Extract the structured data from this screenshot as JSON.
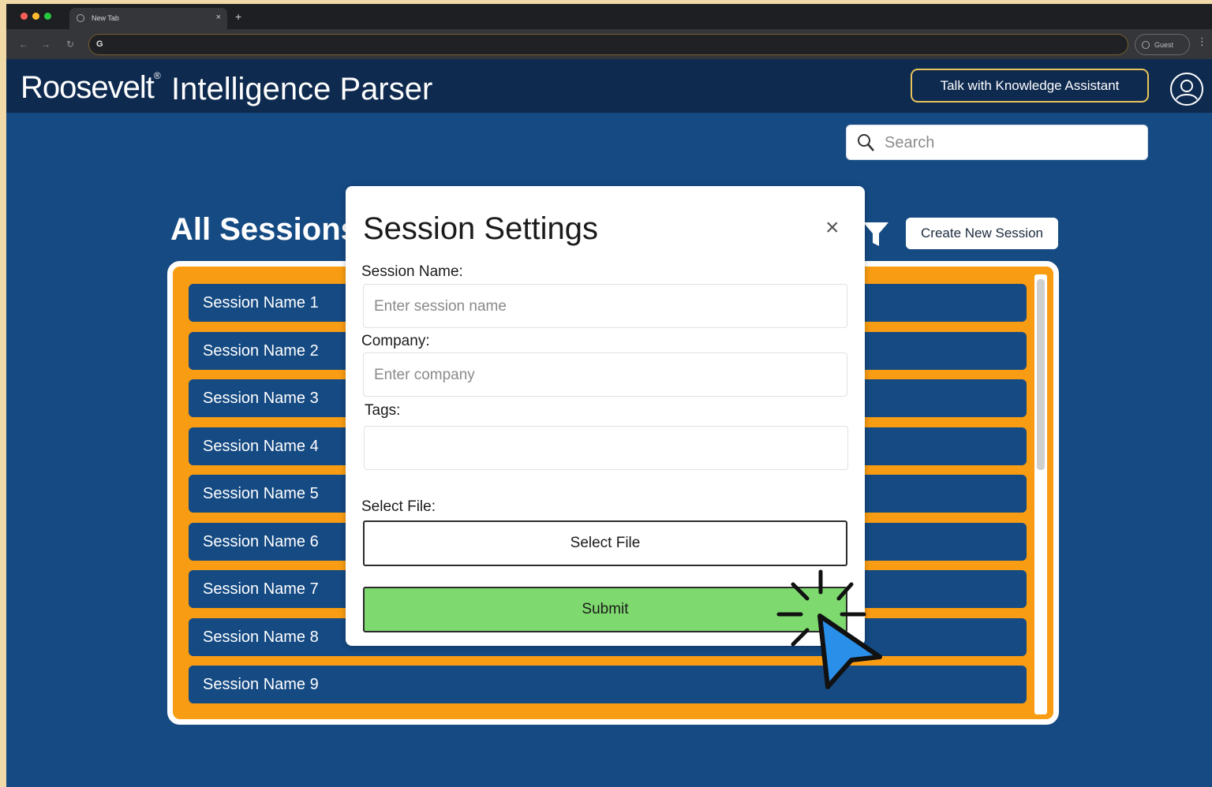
{
  "browser": {
    "tab_title": "New Tab",
    "tab_close": "×",
    "new_tab": "+",
    "omnibox_icon": "G",
    "guest_label": "Guest",
    "menu": "⋮",
    "nav_back": "←",
    "nav_forward": "→",
    "reload": "↻"
  },
  "header": {
    "logo": "Roosevelt",
    "logo_mark": "®",
    "title": "Intelligence Parser",
    "assistant_label": "Talk with Knowledge Assistant"
  },
  "search": {
    "placeholder": "Search"
  },
  "sessions": {
    "title": "All Sessions",
    "create_label": "Create New Session",
    "items": [
      "Session Name 1",
      "Session Name 2",
      "Session Name 3",
      "Session Name 4",
      "Session Name 5",
      "Session Name 6",
      "Session Name 7",
      "Session Name 8",
      "Session Name 9"
    ]
  },
  "modal": {
    "title": "Session Settings",
    "close": "×",
    "session_name_label": "Session Name:",
    "session_name_placeholder": "Enter session name",
    "company_label": "Company:",
    "company_placeholder": "Enter company",
    "tags_label": "Tags:",
    "select_file_label": "Select File:",
    "select_file_button": "Select File",
    "submit_button": "Submit"
  },
  "colors": {
    "page_bg": "#154a83",
    "header_bg": "#0e2a4f",
    "accent_gold": "#e8c45a",
    "panel_orange": "#f89c13",
    "submit_green": "#7ed96f",
    "cursor_blue": "#2a8fe8"
  },
  "icons": {
    "search": "search-icon",
    "filter": "filter-icon",
    "user": "user-icon",
    "close": "close-icon",
    "cursor": "click-cursor-icon"
  }
}
